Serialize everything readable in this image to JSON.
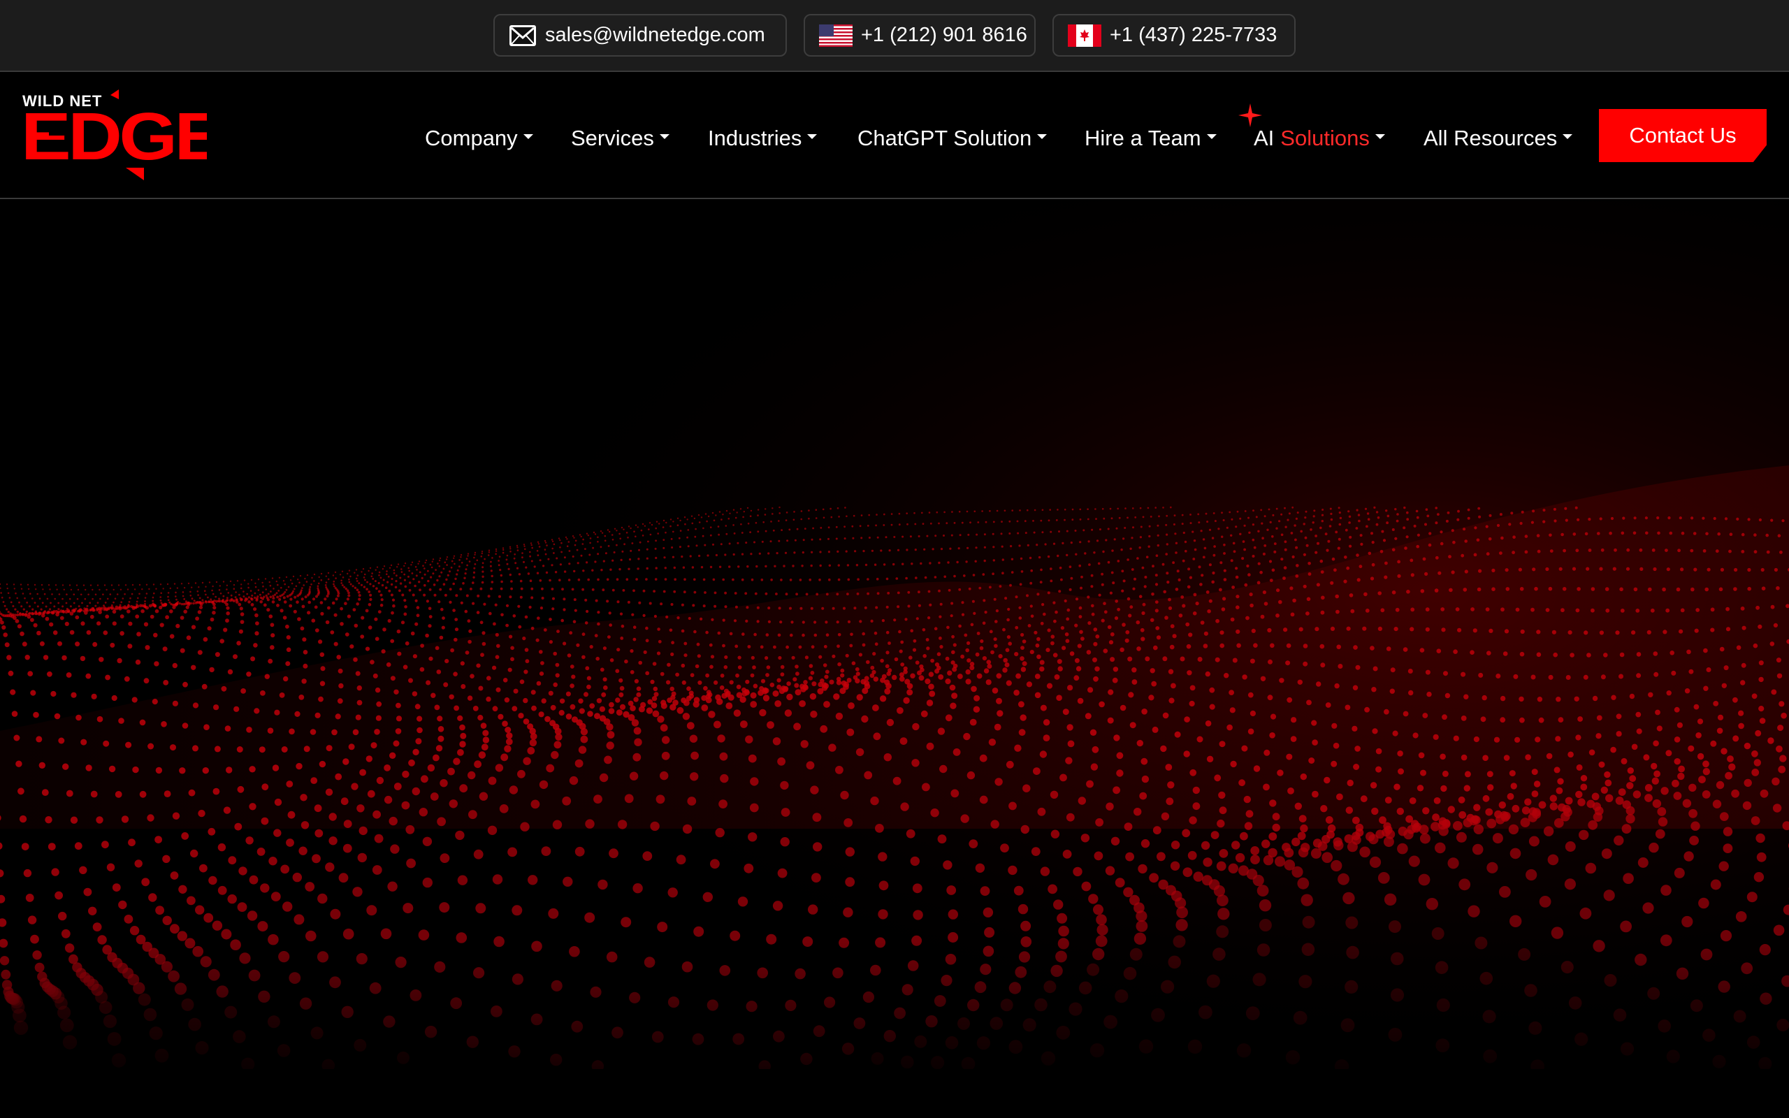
{
  "topbar": {
    "email": "sales@wildnetedge.com",
    "phone_us": "+1 (212) 901 8616",
    "phone_ca": "+1 (437) 225-7733",
    "icons": [
      "mail-icon",
      "us-flag-icon",
      "canada-flag-icon"
    ]
  },
  "brand": {
    "name_small": "WILD NET",
    "name_large": "EDGE",
    "accent_color": "#ff0000"
  },
  "nav": {
    "items": [
      {
        "label": "Company"
      },
      {
        "label": "Services"
      },
      {
        "label": "Industries"
      },
      {
        "label": "ChatGPT Solution"
      },
      {
        "label": "Hire a Team"
      },
      {
        "label": "AI",
        "accent_label": "Solutions",
        "icon": "sparkle-icon"
      },
      {
        "label": "All Resources"
      }
    ],
    "cta_label": "Contact Us"
  },
  "hero": {
    "background": "red-particle-wave"
  }
}
